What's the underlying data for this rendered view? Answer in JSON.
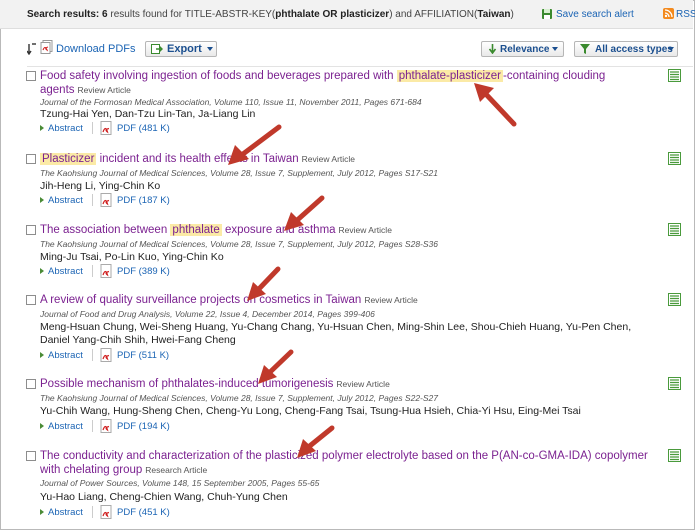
{
  "header": {
    "summary_prefix": "Search results:",
    "summary_count": "6",
    "summary_mid": "results found for TITLE-ABSTR-KEY(",
    "summary_query": "phthalate OR plasticizer",
    "summary_mid2": ") and AFFILIATION(",
    "summary_affil": "Taiwan",
    "summary_end": ")",
    "save_alert": "Save search alert",
    "rss": "RSS"
  },
  "toolbar": {
    "download_pdfs": "Download PDFs",
    "export": "Export",
    "relevance": "Relevance",
    "access_types": "All access types"
  },
  "results": [
    {
      "title_pre": "Food safety involving ingestion of foods and beverages prepared with ",
      "title_hl": "phthalate-plasticizer",
      "title_post": "-containing clouding agents",
      "type": "Review Article",
      "journal": "Journal of the Formosan Medical Association, Volume 110, Issue 11, November 2011, Pages 671-684",
      "authors": "Tzung-Hai Yen, Dan-Tzu Lin-Tan, Ja-Liang Lin",
      "abstract": "Abstract",
      "pdf": "PDF (481 K)"
    },
    {
      "title_pre": "",
      "title_hl": "Plasticizer",
      "title_post": " incident and its health effects in Taiwan",
      "type": "Review Article",
      "journal": "The Kaohsiung Journal of Medical Sciences, Volume 28, Issue 7, Supplement, July 2012, Pages S17-S21",
      "authors": "Jih-Heng Li, Ying-Chin Ko",
      "abstract": "Abstract",
      "pdf": "PDF (187 K)"
    },
    {
      "title_pre": "The association between ",
      "title_hl": "phthalate",
      "title_post": " exposure and asthma",
      "type": "Review Article",
      "journal": "The Kaohsiung Journal of Medical Sciences, Volume 28, Issue 7, Supplement, July 2012, Pages S28-S36",
      "authors": "Ming-Ju Tsai, Po-Lin Kuo, Ying-Chin Ko",
      "abstract": "Abstract",
      "pdf": "PDF (389 K)"
    },
    {
      "title_pre": "A review of quality surveillance projects on cosmetics in Taiwan",
      "title_hl": "",
      "title_post": "",
      "type": "Review Article",
      "journal": "Journal of Food and Drug Analysis, Volume 22, Issue 4, December 2014, Pages 399-406",
      "authors": "Meng-Hsuan Chung, Wei-Sheng Huang, Yu-Chang Chang, Yu-Hsuan Chen, Ming-Shin Lee, Shou-Chieh Huang, Yu-Pen Chen, Daniel Yang-Chih Shih, Hwei-Fang Cheng",
      "abstract": "Abstract",
      "pdf": "PDF (511 K)"
    },
    {
      "title_pre": "Possible mechanism of phthalates-induced tumorigenesis",
      "title_hl": "",
      "title_post": "",
      "type": "Review Article",
      "journal": "The Kaohsiung Journal of Medical Sciences, Volume 28, Issue 7, Supplement, July 2012, Pages S22-S27",
      "authors": "Yu-Chih Wang, Hung-Sheng Chen, Cheng-Yu Long, Cheng-Fang Tsai, Tsung-Hua Hsieh, Chia-Yi Hsu, Eing-Mei Tsai",
      "abstract": "Abstract",
      "pdf": "PDF (194 K)"
    },
    {
      "title_pre": "The conductivity and characterization of the plasticized polymer electrolyte based on the P(AN-co-GMA-IDA) copolymer with chelating group",
      "title_hl": "",
      "title_post": "",
      "type": "Research Article",
      "journal": "Journal of Power Sources, Volume 148, 15 September 2005, Pages 55-65",
      "authors": "Yu-Hao Liang, Cheng-Chien Wang, Chuh-Yung Chen",
      "abstract": "Abstract",
      "pdf": "PDF (451 K)"
    }
  ],
  "colors": {
    "title": "#7b2190",
    "link": "#1b64b4",
    "highlight": "#fbeaa6",
    "arrow": "#c0392b",
    "preview": "#4a9a3c"
  }
}
